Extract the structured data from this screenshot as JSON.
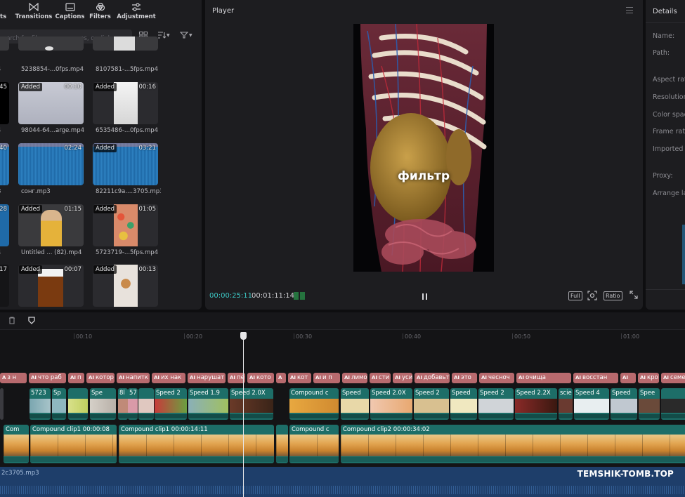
{
  "media": {
    "tabs": [
      {
        "label": "ts",
        "icon": "media-icon"
      },
      {
        "label": "Transitions",
        "icon": "transitions-icon"
      },
      {
        "label": "Captions",
        "icon": "captions-icon"
      },
      {
        "label": "Filters",
        "icon": "filters-icon"
      },
      {
        "label": "Adjustment",
        "icon": "adjustment-icon"
      }
    ],
    "search_placeholder": "earch for file names, scenes, or dialogs",
    "added_label": "Added",
    "left_partial": [
      {
        "name": "4",
        "duration": ""
      },
      {
        "name": "4",
        "duration": "45"
      },
      {
        "name": "3",
        "duration": "40"
      },
      {
        "name": "4",
        "duration": "28"
      },
      {
        "name": "4",
        "duration": "17"
      }
    ],
    "items": [
      {
        "name": "5238854-...0fps.mp4",
        "duration": ""
      },
      {
        "name": "8107581-...5fps.mp4",
        "duration": ""
      },
      {
        "name": "98044-64...arge.mp4",
        "duration": "00:10"
      },
      {
        "name": "6535486-...0fps.mp4",
        "duration": "00:16"
      },
      {
        "name": "сонг.mp3",
        "duration": "02:24"
      },
      {
        "name": "82211c9a....3705.mp3",
        "duration": "03:21"
      },
      {
        "name": "Untitled ... (82).mp4",
        "duration": "01:15"
      },
      {
        "name": "5723719-...5fps.mp4",
        "duration": "01:05"
      },
      {
        "name": "",
        "duration": "00:07"
      },
      {
        "name": "",
        "duration": "00:13"
      }
    ]
  },
  "player": {
    "title": "Player",
    "caption": "фильтр",
    "current_time": "00:00:25:11",
    "total_time": "00:01:11:14",
    "full_label": "Full",
    "ratio_label": "Ratio"
  },
  "details": {
    "title": "Details",
    "labels": [
      "Name:",
      "Path:",
      "Aspect rat",
      "Resolution",
      "Color spac",
      "Frame rat",
      "Imported",
      "Proxy:",
      "Arrange la"
    ]
  },
  "timeline": {
    "ruler": [
      "00:10",
      "00:20",
      "00:30",
      "00:40",
      "00:50",
      "01:00"
    ],
    "text_clips": [
      "з н",
      "что раб",
      "п",
      "котор",
      "напитк",
      "их нак",
      "нарушат",
      "пе",
      "кото",
      "",
      "кот",
      "и п",
      "лимо",
      "сти",
      "уси",
      "добавьт",
      "это",
      "чесноч",
      "очища",
      "восстан",
      "",
      "кро",
      "семе"
    ],
    "overlay_clips": [
      "5723",
      "Sp",
      "Spe",
      "8l",
      "57",
      "Speed 2",
      "Speed 1.9",
      "Speed 2.0X",
      "Compound c",
      "Speed",
      "Speed 2.0X",
      "Speed 2",
      "Speed",
      "Speed 2",
      "Speed 2.2X",
      "scie",
      "Speed 4",
      "Speed",
      "Spee"
    ],
    "main_clips": [
      "Com",
      "Compound clip1  00:00:08",
      "Compound clip1  00:00:14:11",
      "",
      "Compound c",
      "Compound clip2  00:00:34:02"
    ],
    "audio_label": "2c3705.mp3"
  },
  "watermark": "TEMSHIK-TOMB.TOP",
  "colors": {
    "accent": "#3cc8c5",
    "text_clip": "#b86a6e",
    "video_clip": "#1d6e68",
    "audio_track": "#1e3e6a"
  }
}
